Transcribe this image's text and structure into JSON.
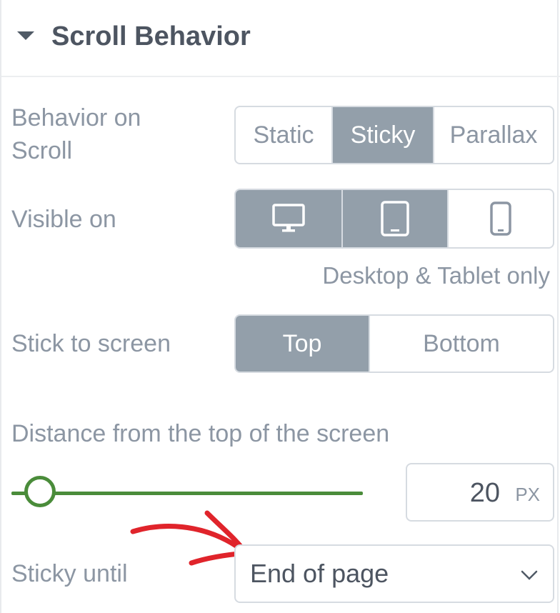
{
  "section": {
    "title": "Scroll Behavior"
  },
  "behavior_on_scroll": {
    "label_line1": "Behavior on",
    "label_line2": "Scroll",
    "options": [
      "Static",
      "Sticky",
      "Parallax"
    ],
    "selected": "Sticky"
  },
  "visible_on": {
    "label": "Visible on",
    "devices": [
      {
        "name": "desktop",
        "icon": "desktop-icon",
        "selected": true
      },
      {
        "name": "tablet",
        "icon": "tablet-icon",
        "selected": true
      },
      {
        "name": "mobile",
        "icon": "mobile-icon",
        "selected": false
      }
    ],
    "hint": "Desktop & Tablet only"
  },
  "stick_to_screen": {
    "label": "Stick to screen",
    "options": [
      "Top",
      "Bottom"
    ],
    "selected": "Top"
  },
  "distance": {
    "label": "Distance from the top of the screen",
    "value": "20",
    "unit": "PX",
    "slider_fraction": 0.09
  },
  "sticky_until": {
    "label": "Sticky until",
    "value": "End of page"
  },
  "colors": {
    "active_segment": "#939faa",
    "slider": "#4a8c3a",
    "annotation_arrow": "#e0242b",
    "title": "#4d5561",
    "label": "#8c96a3"
  }
}
